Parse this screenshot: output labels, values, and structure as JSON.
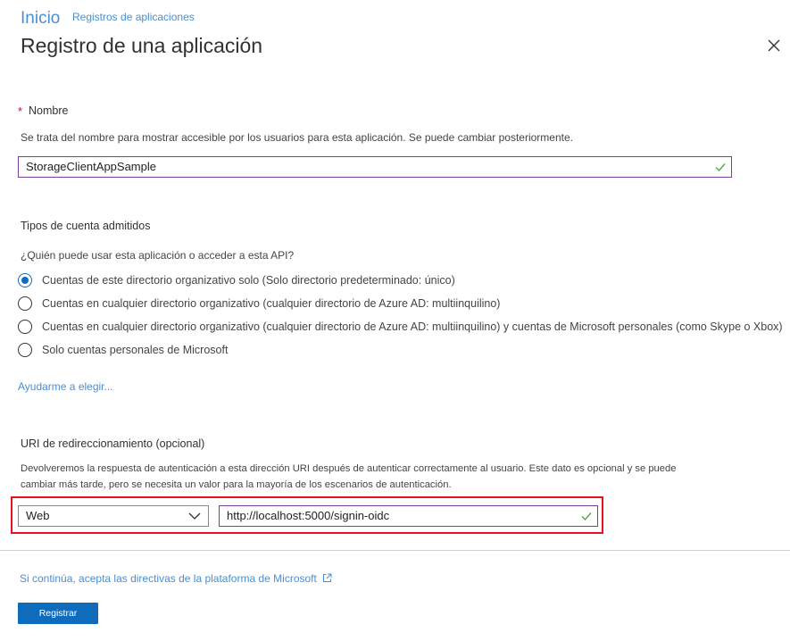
{
  "breadcrumb": {
    "home": "Inicio",
    "current": "Registros de aplicaciones"
  },
  "page_title": "Registro de una aplicación",
  "name_section": {
    "required_marker": "*",
    "label": "Nombre",
    "description": "Se trata del nombre para mostrar accesible por los usuarios para esta aplicación. Se puede cambiar posteriormente.",
    "value": "StorageClientAppSample"
  },
  "account_types": {
    "heading": "Tipos de cuenta admitidos",
    "question": "¿Quién puede usar esta aplicación o acceder a esta API?",
    "options": [
      {
        "label": "Cuentas de este directorio organizativo solo (Solo directorio predeterminado: único)",
        "selected": true
      },
      {
        "label": "Cuentas en cualquier directorio organizativo (cualquier directorio de Azure AD: multiinquilino)",
        "selected": false
      },
      {
        "label": "Cuentas en cualquier directorio organizativo (cualquier directorio de Azure AD: multiinquilino) y cuentas de Microsoft personales (como Skype o Xbox)",
        "selected": false
      },
      {
        "label": "Solo cuentas personales de Microsoft",
        "selected": false
      }
    ],
    "help_link": "Ayudarme a elegir..."
  },
  "redirect_uri": {
    "heading": "URI de redireccionamiento (opcional)",
    "description_line1": "Devolveremos la respuesta de autenticación a esta dirección URI después de autenticar correctamente al usuario. Este dato es opcional y se puede",
    "description_line2": "cambiar más tarde, pero se necesita un valor para la mayoría de los escenarios de autenticación.",
    "platform_value": "Web",
    "uri_value": "http://localhost:5000/signin-oidc"
  },
  "footer": {
    "policy_link": "Si continúa, acepta las directivas de la plataforma de Microsoft",
    "register_button": "Registrar"
  },
  "icons": {
    "close": "close-icon",
    "check": "checkmark-icon",
    "chevron": "chevron-down-icon",
    "external": "external-link-icon"
  },
  "colors": {
    "accent": "#0f6cbd",
    "link": "#4a8ed1",
    "input_border": "#7d3f98",
    "valid_check": "#57a64a",
    "highlight": "#e81123",
    "required": "#c50f1f"
  }
}
